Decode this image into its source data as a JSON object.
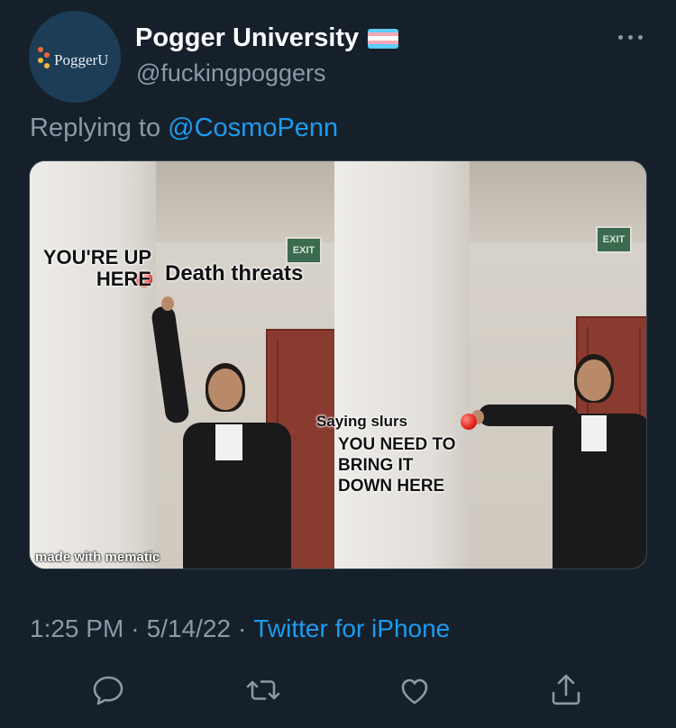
{
  "tweet": {
    "display_name": "Pogger University",
    "handle": "@fuckingpoggers",
    "avatar_text": "PoggerU",
    "replying_prefix": "Replying to",
    "replying_to": "@CosmoPenn",
    "time": "1:25 PM",
    "sep1": "·",
    "date": "5/14/22",
    "sep2": "·",
    "source": "Twitter for iPhone"
  },
  "meme": {
    "youre_up_here": "YOU'RE UP\nHERE",
    "death_threats": "Death threats",
    "saying_slurs": "Saying slurs",
    "bring_it_down": "YOU NEED TO\nBRING IT\nDOWN HERE",
    "watermark": "made with mematic",
    "exit_sign": "EXIT"
  },
  "icons": {
    "more": "more-dots-icon",
    "reply": "reply-icon",
    "retweet": "retweet-icon",
    "like": "like-icon",
    "share": "share-icon",
    "flag": "trans-flag-icon"
  },
  "colors": {
    "background": "#15202b",
    "secondary_text": "#8b98a5",
    "link": "#1d9bf0",
    "flag_blue": "#5bcefa",
    "flag_pink": "#f5a9b8",
    "flag_white": "#ffffff"
  }
}
